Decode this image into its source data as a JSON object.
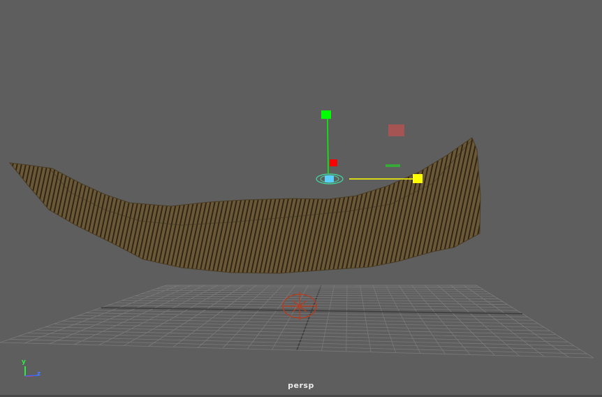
{
  "viewport": {
    "camera_name": "persp",
    "background_color": "#5e5e5e",
    "grid_color": "#7a7a7a",
    "grid_axis_color": "#3c3c3c"
  },
  "surface": {
    "fill_color": "#6b5836",
    "stripe_color": "#2f2618",
    "edge_color": "#4a3d25"
  },
  "manipulator": {
    "y_handle_color": "#00ff00",
    "x_handle_color": "#ffff00",
    "z_handle_color": "#ff0000",
    "center_color": "#5ad0ff",
    "plane_handle_color": "#b85050"
  },
  "origin_marker_color": "#b63c1e",
  "axis_gizmo": {
    "y_label": "y",
    "z_label": "z",
    "y_color": "#2dea46",
    "x_color": "#e03030",
    "z_color": "#3a6bff"
  }
}
